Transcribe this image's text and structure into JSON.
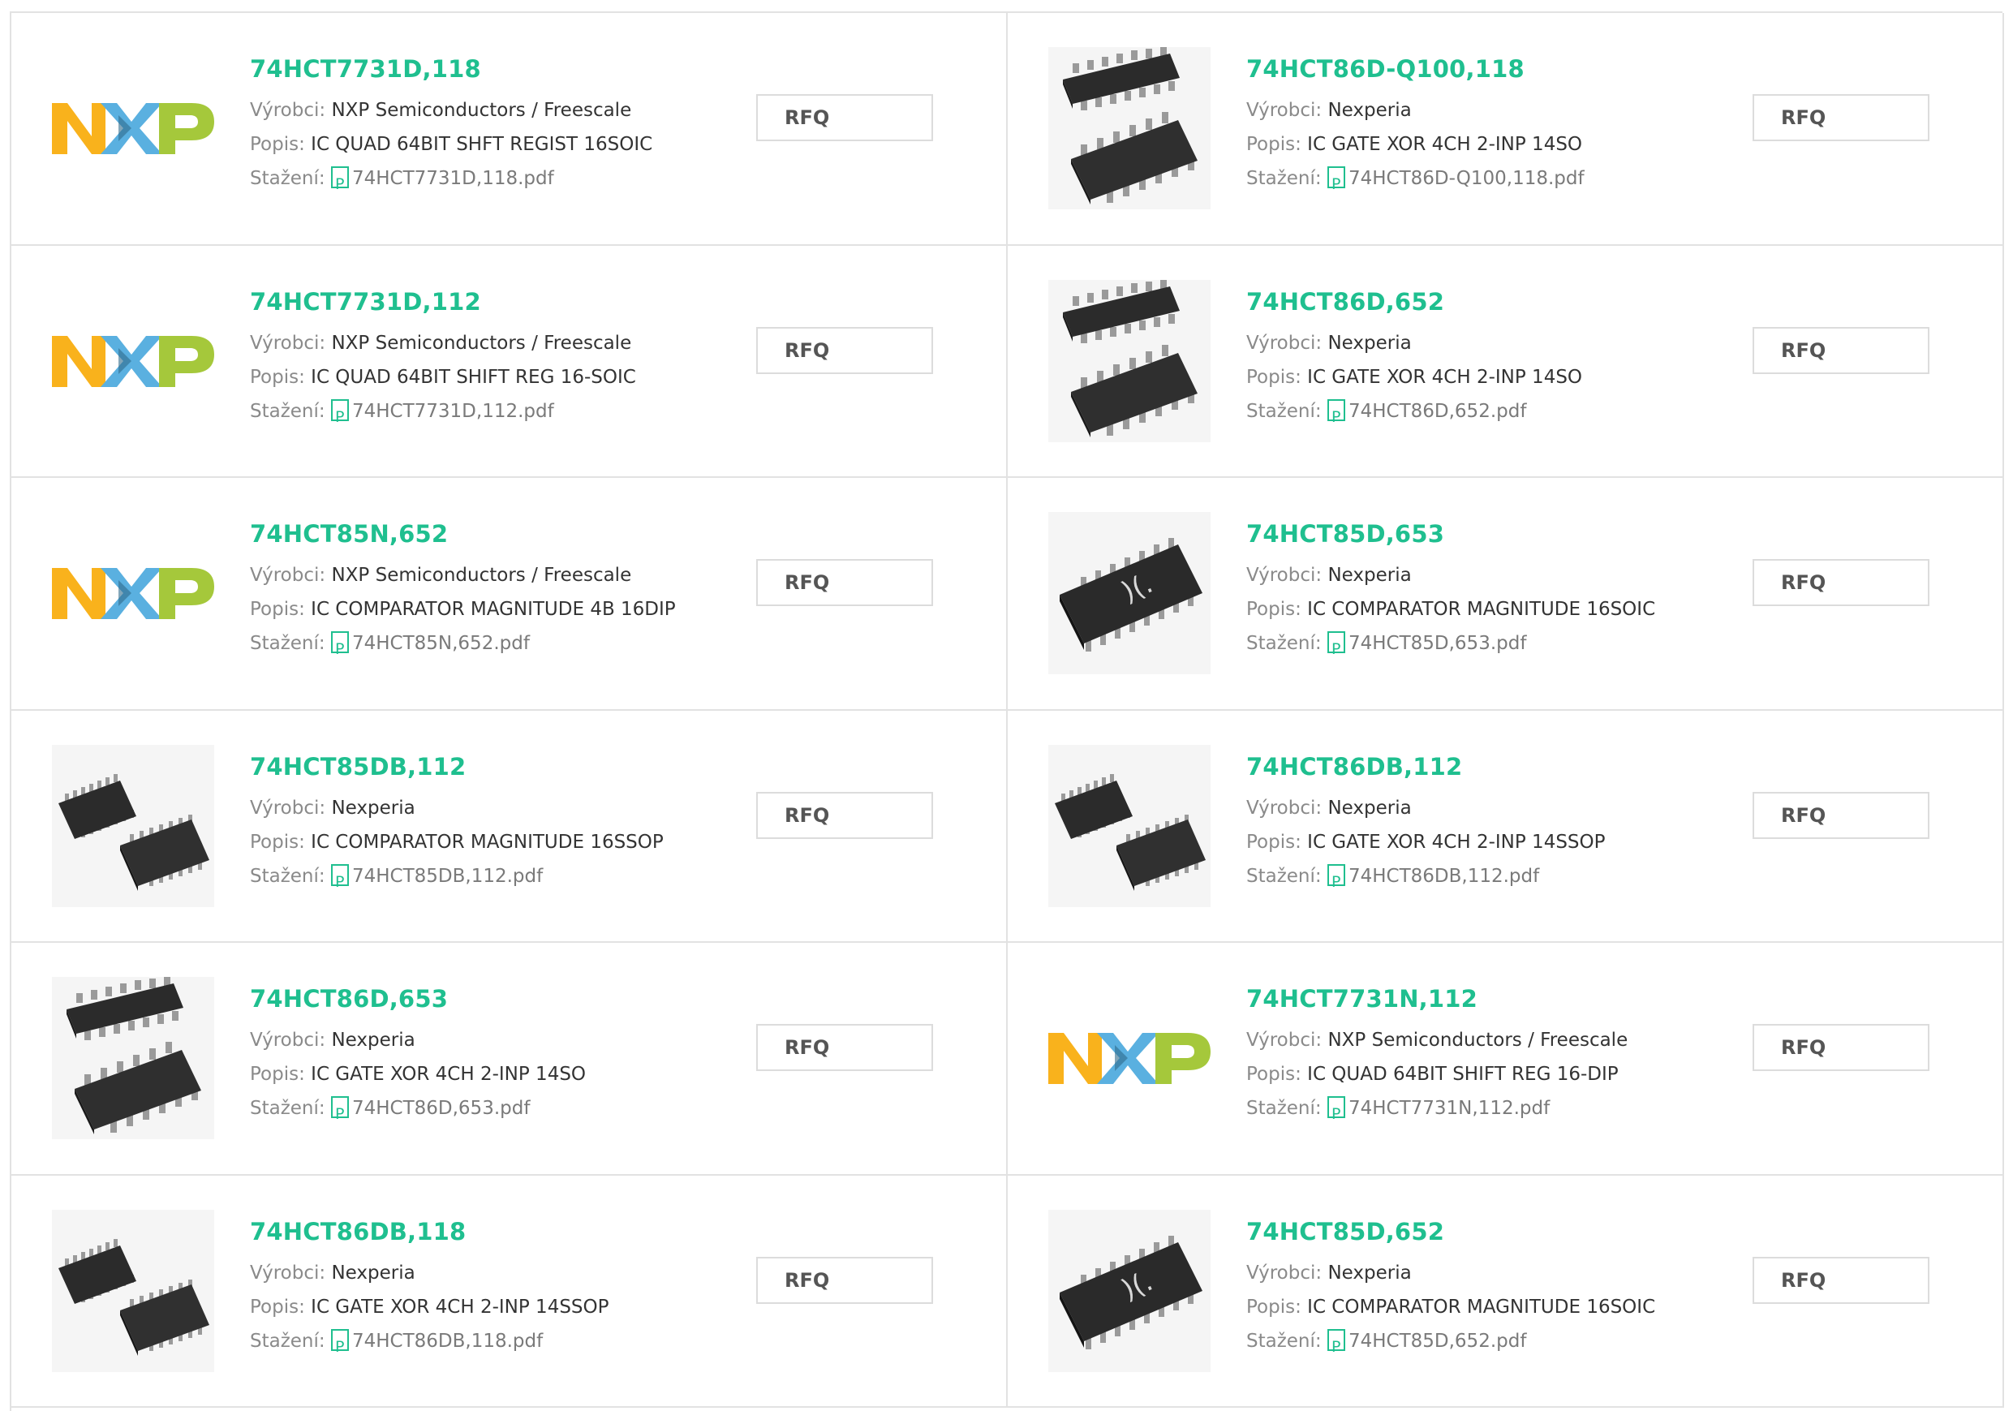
{
  "labels": {
    "maker": "Výrobci:",
    "desc": "Popis:",
    "download": "Stažení:",
    "rfq": "RFQ"
  },
  "colors": {
    "accent": "#1fbf8f",
    "border": "#e2e2e2"
  },
  "products": [
    {
      "part": "74HCT7731D,118",
      "maker": "NXP Semiconductors / Freescale",
      "desc": "IC QUAD 64BIT SHFT REGIST 16SOIC",
      "pdf": "74HCT7731D,118.pdf",
      "image": "nxp-logo"
    },
    {
      "part": "74HCT86D-Q100,118",
      "maker": "Nexperia",
      "desc": "IC GATE XOR 4CH 2-INP 14SO",
      "pdf": "74HCT86D-Q100,118.pdf",
      "image": "soic-pair"
    },
    {
      "part": "74HCT7731D,112",
      "maker": "NXP Semiconductors / Freescale",
      "desc": "IC QUAD 64BIT SHIFT REG 16-SOIC",
      "pdf": "74HCT7731D,112.pdf",
      "image": "nxp-logo"
    },
    {
      "part": "74HCT86D,652",
      "maker": "Nexperia",
      "desc": "IC GATE XOR 4CH 2-INP 14SO",
      "pdf": "74HCT86D,652.pdf",
      "image": "soic-pair"
    },
    {
      "part": "74HCT85N,652",
      "maker": "NXP Semiconductors / Freescale",
      "desc": "IC COMPARATOR MAGNITUDE 4B 16DIP",
      "pdf": "74HCT85N,652.pdf",
      "image": "nxp-logo"
    },
    {
      "part": "74HCT85D,653",
      "maker": "Nexperia",
      "desc": "IC COMPARATOR MAGNITUDE 16SOIC",
      "pdf": "74HCT85D,653.pdf",
      "image": "soic-single"
    },
    {
      "part": "74HCT85DB,112",
      "maker": "Nexperia",
      "desc": "IC COMPARATOR MAGNITUDE 16SSOP",
      "pdf": "74HCT85DB,112.pdf",
      "image": "ssop-pair"
    },
    {
      "part": "74HCT86DB,112",
      "maker": "Nexperia",
      "desc": "IC GATE XOR 4CH 2-INP 14SSOP",
      "pdf": "74HCT86DB,112.pdf",
      "image": "ssop-pair"
    },
    {
      "part": "74HCT86D,653",
      "maker": "Nexperia",
      "desc": "IC GATE XOR 4CH 2-INP 14SO",
      "pdf": "74HCT86D,653.pdf",
      "image": "soic-pair"
    },
    {
      "part": "74HCT7731N,112",
      "maker": "NXP Semiconductors / Freescale",
      "desc": "IC QUAD 64BIT SHIFT REG 16-DIP",
      "pdf": "74HCT7731N,112.pdf",
      "image": "nxp-logo"
    },
    {
      "part": "74HCT86DB,118",
      "maker": "Nexperia",
      "desc": "IC GATE XOR 4CH 2-INP 14SSOP",
      "pdf": "74HCT86DB,118.pdf",
      "image": "ssop-pair"
    },
    {
      "part": "74HCT85D,652",
      "maker": "Nexperia",
      "desc": "IC COMPARATOR MAGNITUDE 16SOIC",
      "pdf": "74HCT85D,652.pdf",
      "image": "soic-single"
    }
  ]
}
